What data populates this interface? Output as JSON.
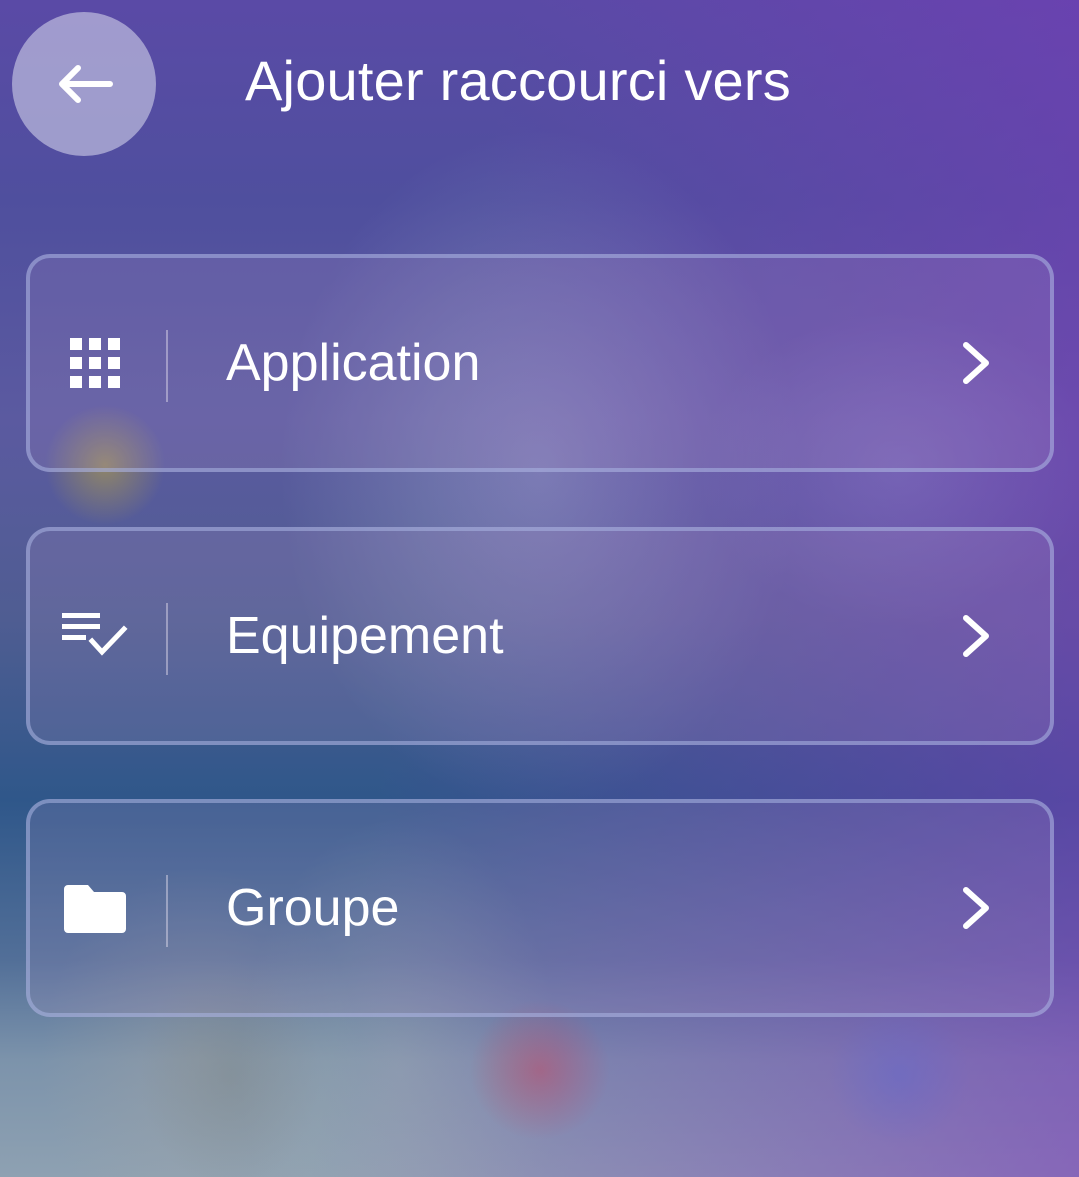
{
  "header": {
    "title": "Ajouter raccourci vers",
    "back_icon": "arrow-left-icon"
  },
  "menu": {
    "items": [
      {
        "label": "Application",
        "icon": "apps-grid-icon"
      },
      {
        "label": "Equipement",
        "icon": "list-check-icon"
      },
      {
        "label": "Groupe",
        "icon": "folder-icon"
      }
    ],
    "trailing_icon": "chevron-right-icon"
  }
}
